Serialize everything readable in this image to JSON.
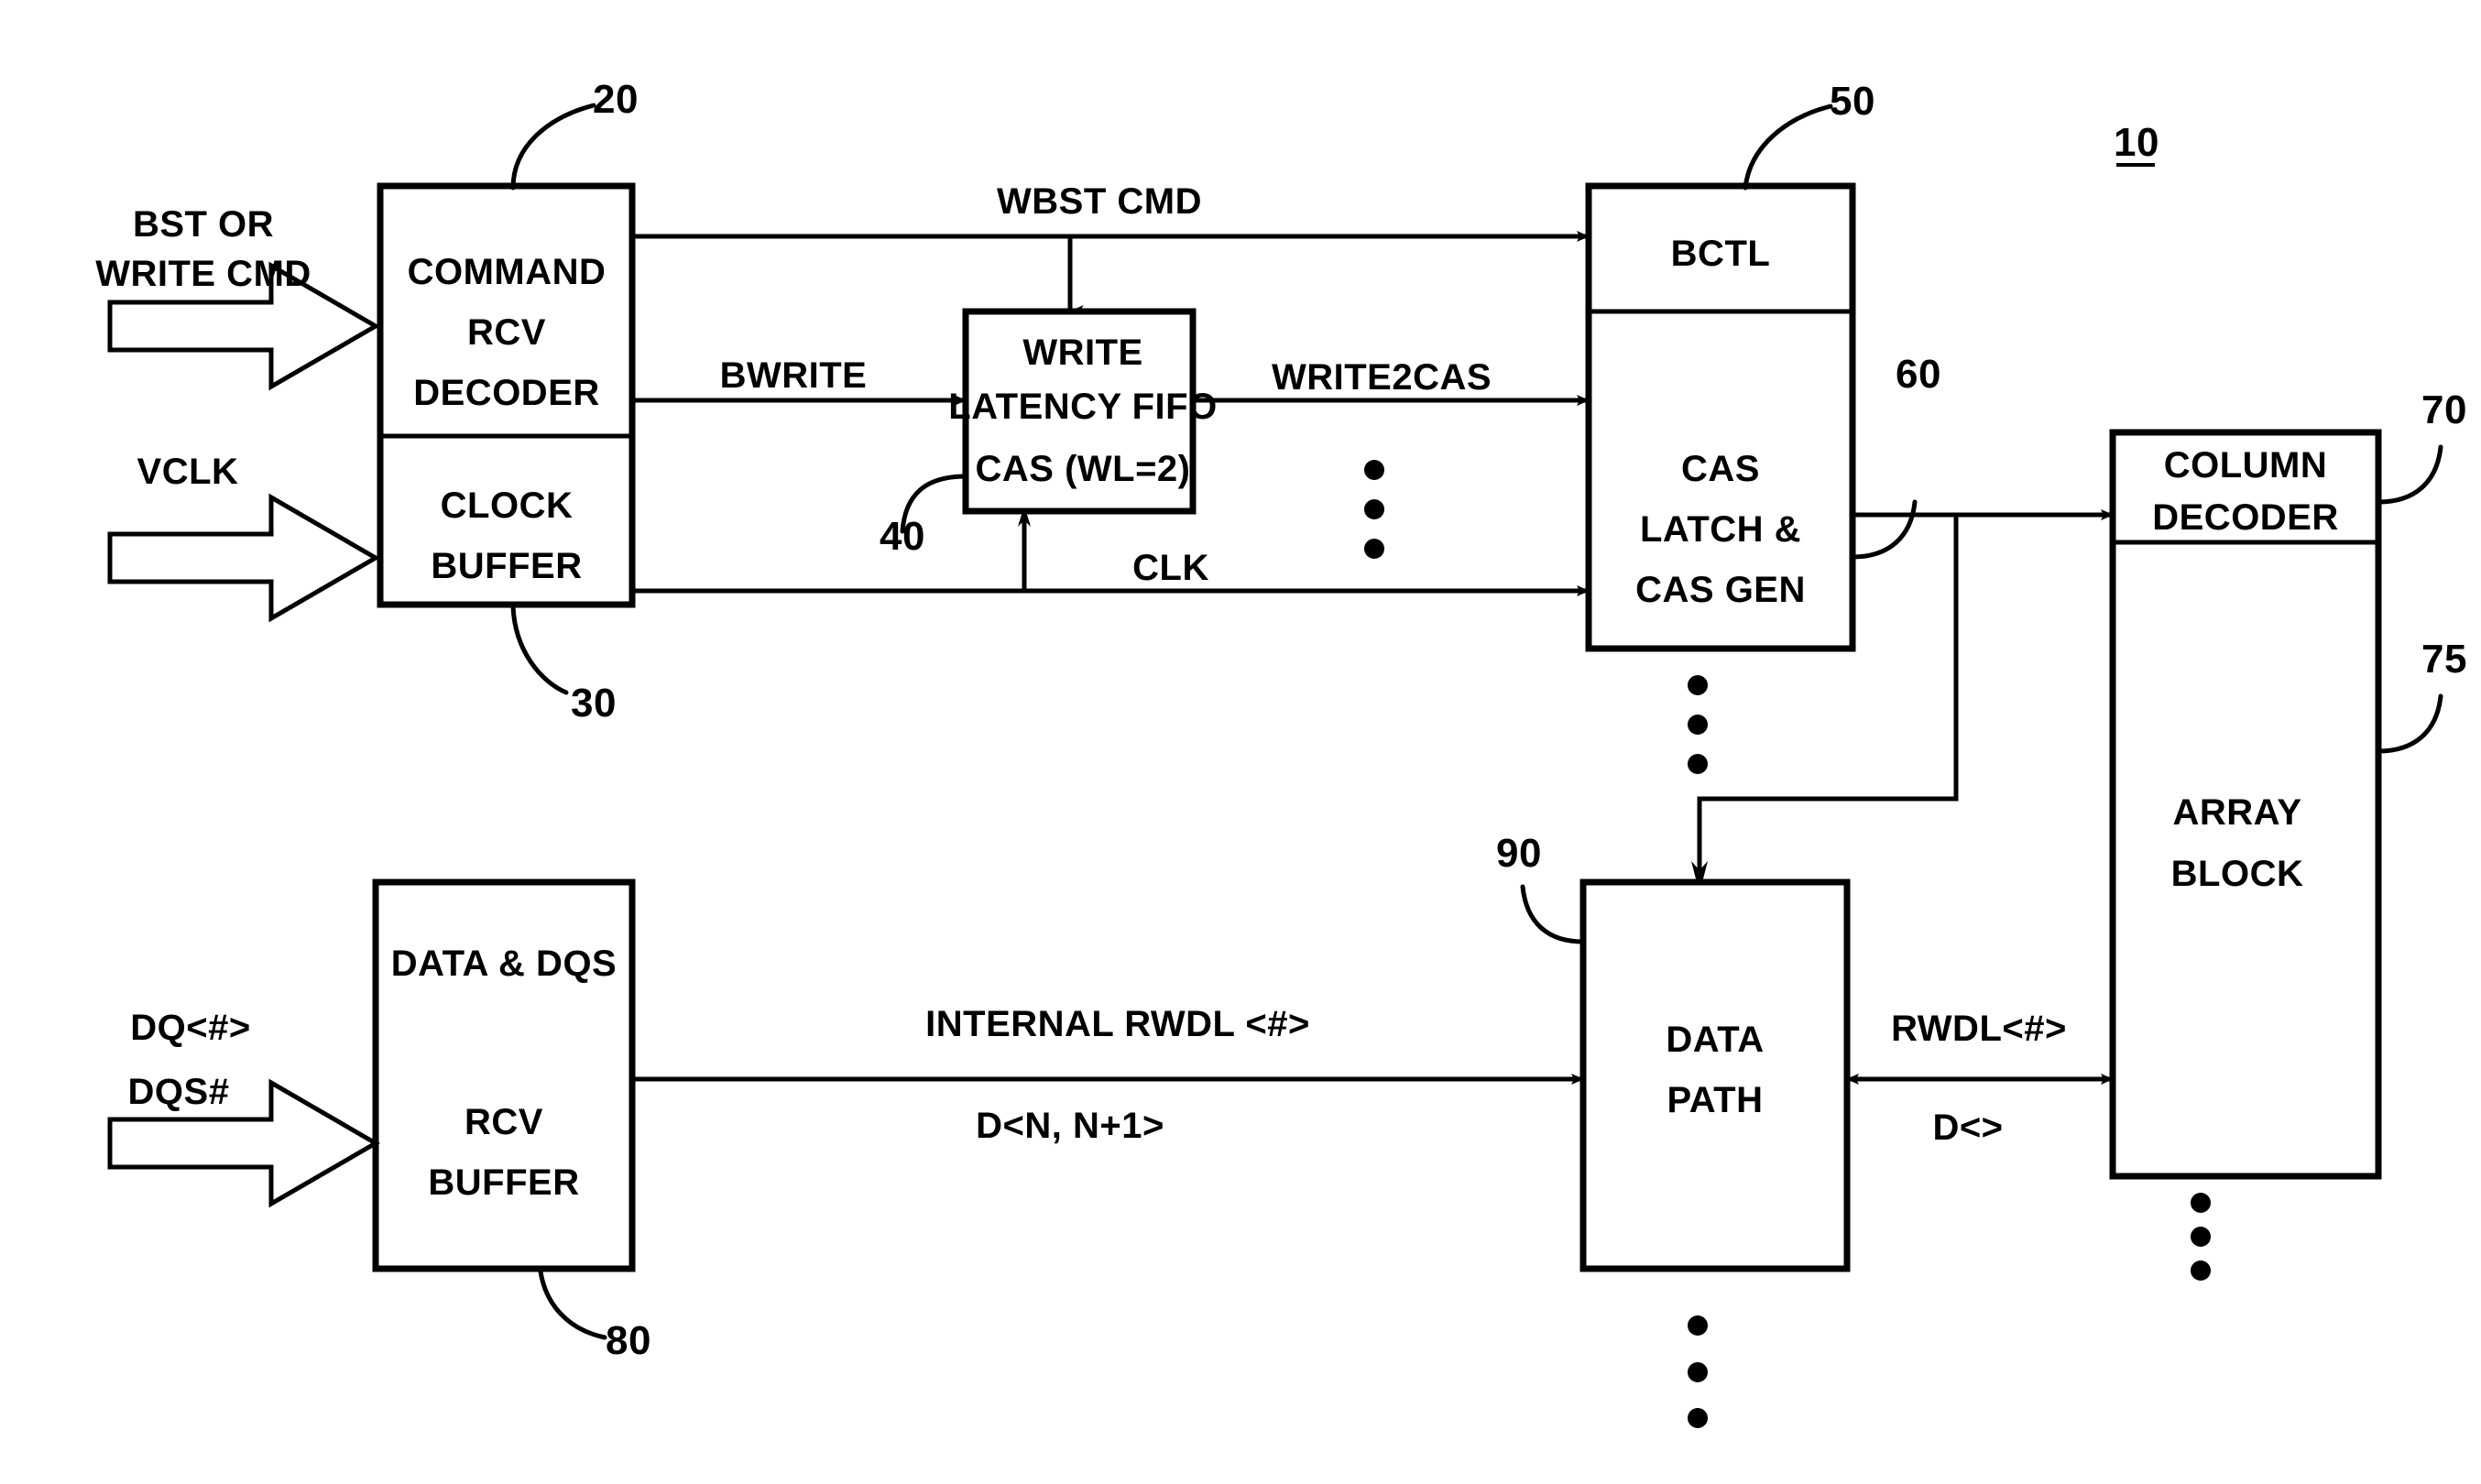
{
  "figure": {
    "id_label": "10",
    "title": "DRAM write path block diagram"
  },
  "blocks": [
    {
      "key": "command_rcv_decoder",
      "lines": [
        "COMMAND",
        "RCV",
        "DECODER"
      ],
      "ref": "20"
    },
    {
      "key": "clock_buffer",
      "lines": [
        "CLOCK",
        "BUFFER"
      ],
      "ref": "30"
    },
    {
      "key": "write_latency_fifo",
      "lines": [
        "WRITE",
        "LATENCY FIFO",
        "CAS (WL=2)"
      ],
      "ref": "40"
    },
    {
      "key": "bctl",
      "lines": [
        "BCTL"
      ],
      "ref": "50"
    },
    {
      "key": "cas_latch_cas_gen",
      "lines": [
        "CAS",
        "LATCH &",
        "CAS GEN"
      ],
      "ref": "60"
    },
    {
      "key": "column_decoder",
      "lines": [
        "COLUMN",
        "DECODER"
      ],
      "ref": "70"
    },
    {
      "key": "array_block",
      "lines": [
        "ARRAY",
        "BLOCK"
      ],
      "ref": "75"
    },
    {
      "key": "data_dqs_rcv_buffer",
      "lines": [
        "DATA & DQS",
        "RCV",
        "BUFFER"
      ],
      "ref": "80"
    },
    {
      "key": "data_path",
      "lines": [
        "DATA",
        "PATH"
      ],
      "ref": "90"
    }
  ],
  "block_text": {
    "command_rcv_decoder_l1": "COMMAND",
    "command_rcv_decoder_l2": "RCV",
    "command_rcv_decoder_l3": "DECODER",
    "clock_buffer_l1": "CLOCK",
    "clock_buffer_l2": "BUFFER",
    "write_latency_fifo_l1": "WRITE",
    "write_latency_fifo_l2": "LATENCY FIFO",
    "write_latency_fifo_l3": "CAS (WL=2)",
    "bctl_l1": "BCTL",
    "cas_latch_l1": "CAS",
    "cas_latch_l2": "LATCH &",
    "cas_latch_l3": "CAS GEN",
    "column_decoder_l1": "COLUMN",
    "column_decoder_l2": "DECODER",
    "array_block_l1": "ARRAY",
    "array_block_l2": "BLOCK",
    "data_dqs_l1": "DATA & DQS",
    "data_dqs_l2": "RCV",
    "data_dqs_l3": "BUFFER",
    "data_path_l1": "DATA",
    "data_path_l2": "PATH"
  },
  "inputs": [
    {
      "key": "cmd_input",
      "lines": [
        "BST OR",
        "WRITE CMD"
      ]
    },
    {
      "key": "clk_input",
      "lines": [
        "VCLK"
      ]
    },
    {
      "key": "data_input",
      "lines": [
        "DQ<#>",
        "DQS#"
      ]
    }
  ],
  "input_text": {
    "cmd_l1": "BST OR",
    "cmd_l2": "WRITE CMD",
    "vclk_l1": "VCLK",
    "dq_l1": "DQ<#>",
    "dq_l2": "DQS#"
  },
  "signals": {
    "wbst_cmd": "WBST CMD",
    "bwrite": "BWRITE",
    "write2cas": "WRITE2CAS",
    "clk": "CLK",
    "internal_rwdl": "INTERNAL RWDL <#>",
    "d_n_np1": "D<N, N+1>",
    "rwdl": "RWDL<#>",
    "d_empty": "D<>"
  },
  "ref_numbers": {
    "n10": "10",
    "n20": "20",
    "n30": "30",
    "n40": "40",
    "n50": "50",
    "n60": "60",
    "n70": "70",
    "n75": "75",
    "n80": "80",
    "n90": "90"
  },
  "colors": {
    "ink": "#000000",
    "paper": "#ffffff"
  }
}
